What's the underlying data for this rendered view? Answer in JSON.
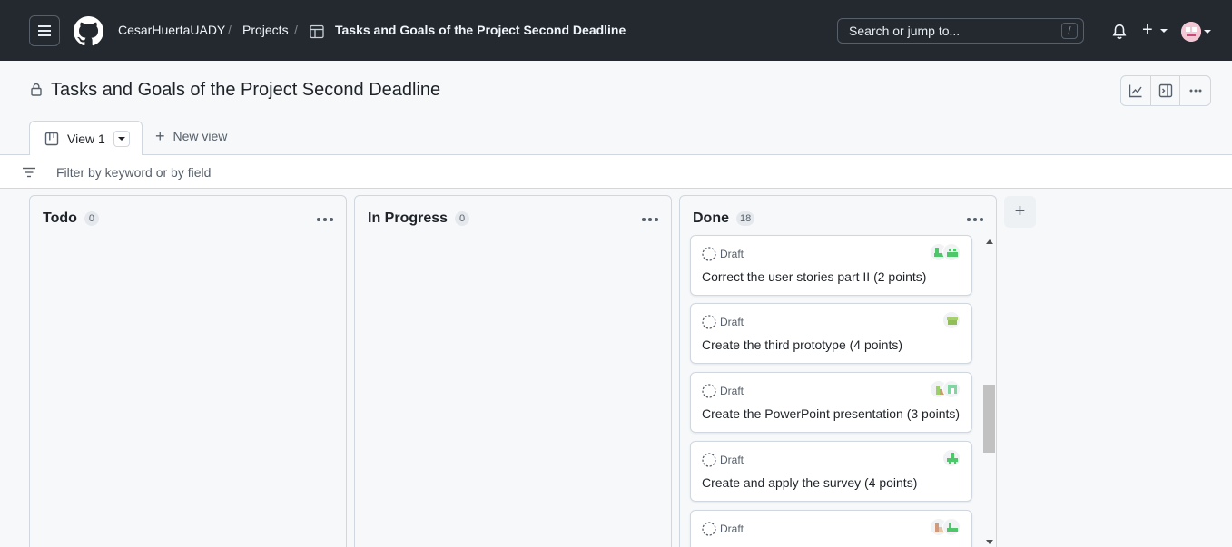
{
  "header": {
    "owner": "CesarHuertaUADY",
    "separator": "/",
    "projects_link": "Projects",
    "project_name": "Tasks and Goals of the Project Second Deadline",
    "search_placeholder": "Search or jump to...",
    "search_shortcut": "/",
    "create_label": "+"
  },
  "project": {
    "title": "Tasks and Goals of the Project Second Deadline",
    "visibility": "private"
  },
  "tabs": {
    "active_view": "View 1",
    "new_view": "New view"
  },
  "filter": {
    "placeholder": "Filter by keyword or by field"
  },
  "columns": [
    {
      "title": "Todo",
      "count": "0",
      "cards": []
    },
    {
      "title": "In Progress",
      "count": "0",
      "cards": []
    },
    {
      "title": "Done",
      "count": "18",
      "cards": [
        {
          "status": "Draft",
          "title": "Correct the user stories part II (2 points)"
        },
        {
          "status": "Draft",
          "title": "Create the third prototype (4 points)"
        },
        {
          "status": "Draft",
          "title": "Create the PowerPoint presentation (3 points)"
        },
        {
          "status": "Draft",
          "title": "Create and apply the survey (4 points)"
        },
        {
          "status": "Draft",
          "title": ""
        }
      ]
    }
  ],
  "add_column_label": "+",
  "colors": {
    "header_bg": "#24292f",
    "page_bg": "#f6f8fa",
    "border": "#d0d7de",
    "muted_text": "#57606a",
    "avatar_green": "#4ec76a"
  }
}
